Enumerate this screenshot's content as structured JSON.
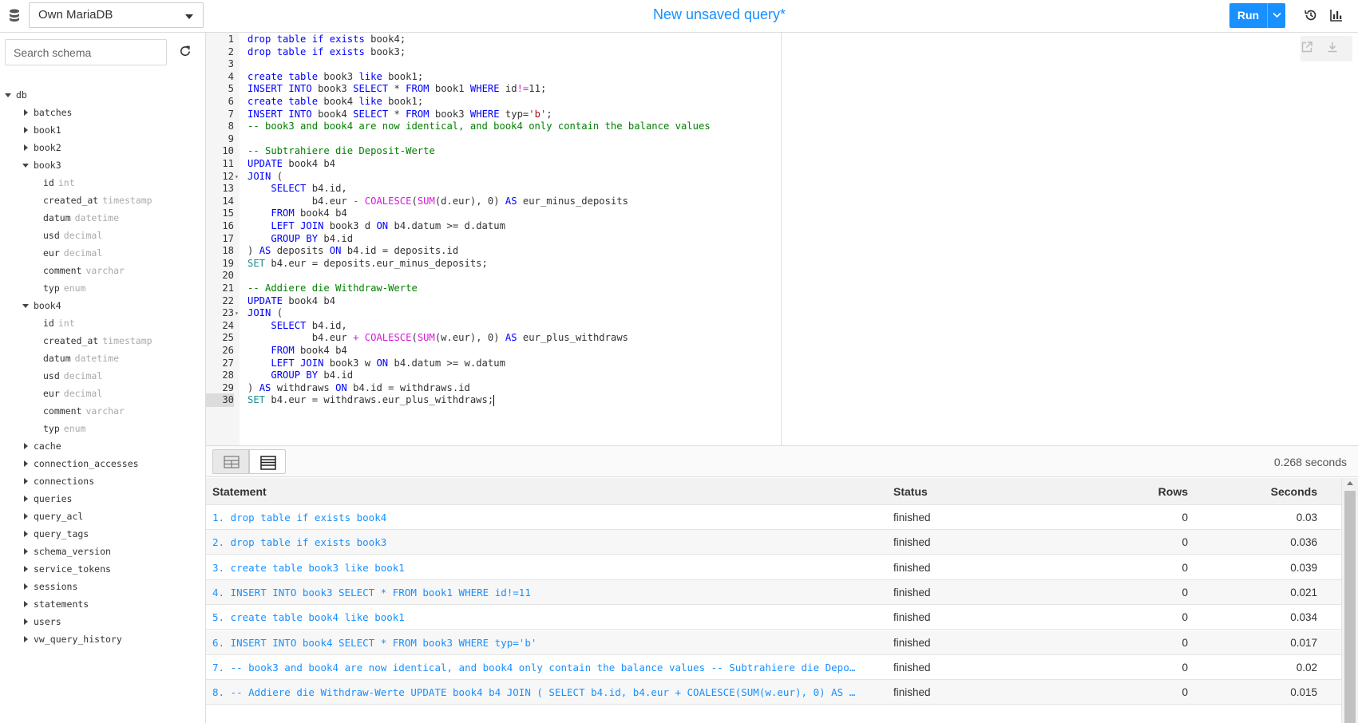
{
  "header": {
    "connection": "Own MariaDB",
    "query_title": "New unsaved query*",
    "run_label": "Run",
    "icons": [
      "database-icon",
      "history-icon",
      "chart-icon"
    ]
  },
  "sidebar": {
    "search_placeholder": "Search schema",
    "tree": [
      {
        "name": "db",
        "expanded": true,
        "level": 0
      },
      {
        "name": "batches",
        "level": 1
      },
      {
        "name": "book1",
        "level": 1
      },
      {
        "name": "book2",
        "level": 1
      },
      {
        "name": "book3",
        "level": 1,
        "expanded": true
      },
      {
        "name": "id",
        "type": "int",
        "level": 2
      },
      {
        "name": "created_at",
        "type": "timestamp",
        "level": 2
      },
      {
        "name": "datum",
        "type": "datetime",
        "level": 2
      },
      {
        "name": "usd",
        "type": "decimal",
        "level": 2
      },
      {
        "name": "eur",
        "type": "decimal",
        "level": 2
      },
      {
        "name": "comment",
        "type": "varchar",
        "level": 2
      },
      {
        "name": "typ",
        "type": "enum",
        "level": 2
      },
      {
        "name": "book4",
        "level": 1,
        "expanded": true
      },
      {
        "name": "id",
        "type": "int",
        "level": 2
      },
      {
        "name": "created_at",
        "type": "timestamp",
        "level": 2
      },
      {
        "name": "datum",
        "type": "datetime",
        "level": 2
      },
      {
        "name": "usd",
        "type": "decimal",
        "level": 2
      },
      {
        "name": "eur",
        "type": "decimal",
        "level": 2
      },
      {
        "name": "comment",
        "type": "varchar",
        "level": 2
      },
      {
        "name": "typ",
        "type": "enum",
        "level": 2
      },
      {
        "name": "cache",
        "level": 1
      },
      {
        "name": "connection_accesses",
        "level": 1
      },
      {
        "name": "connections",
        "level": 1
      },
      {
        "name": "queries",
        "level": 1
      },
      {
        "name": "query_acl",
        "level": 1
      },
      {
        "name": "query_tags",
        "level": 1
      },
      {
        "name": "schema_version",
        "level": 1
      },
      {
        "name": "service_tokens",
        "level": 1
      },
      {
        "name": "sessions",
        "level": 1
      },
      {
        "name": "statements",
        "level": 1
      },
      {
        "name": "users",
        "level": 1
      },
      {
        "name": "vw_query_history",
        "level": 1
      }
    ]
  },
  "editor": {
    "lines": [
      "drop table if exists book4;",
      "drop table if exists book3;",
      "",
      "create table book3 like book1;",
      "INSERT INTO book3 SELECT * FROM book1 WHERE id!=11;",
      "create table book4 like book1;",
      "INSERT INTO book4 SELECT * FROM book3 WHERE typ='b';",
      "-- book3 and book4 are now identical, and book4 only contain the balance values",
      "",
      "-- Subtrahiere die Deposit-Werte",
      "UPDATE book4 b4",
      "JOIN (",
      "    SELECT b4.id,",
      "           b4.eur - COALESCE(SUM(d.eur), 0) AS eur_minus_deposits",
      "    FROM book4 b4",
      "    LEFT JOIN book3 d ON b4.datum >= d.datum",
      "    GROUP BY b4.id",
      ") AS deposits ON b4.id = deposits.id",
      "SET b4.eur = deposits.eur_minus_deposits;",
      "",
      "-- Addiere die Withdraw-Werte",
      "UPDATE book4 b4",
      "JOIN (",
      "    SELECT b4.id,",
      "           b4.eur + COALESCE(SUM(w.eur), 0) AS eur_plus_withdraws",
      "    FROM book4 b4",
      "    LEFT JOIN book3 w ON b4.datum >= w.datum",
      "    GROUP BY b4.id",
      ") AS withdraws ON b4.id = withdraws.id",
      "SET b4.eur = withdraws.eur_plus_withdraws;"
    ],
    "fold_lines": [
      12,
      23
    ],
    "active_line": 30
  },
  "results": {
    "elapsed": "0.268 seconds",
    "columns": [
      "Statement",
      "Status",
      "Rows",
      "Seconds"
    ],
    "rows": [
      [
        "1. drop table if exists book4",
        "finished",
        "0",
        "0.03"
      ],
      [
        "2. drop table if exists book3",
        "finished",
        "0",
        "0.036"
      ],
      [
        "3. create table book3 like book1",
        "finished",
        "0",
        "0.039"
      ],
      [
        "4. INSERT INTO book3 SELECT * FROM book1 WHERE id!=11",
        "finished",
        "0",
        "0.021"
      ],
      [
        "5. create table book4 like book1",
        "finished",
        "0",
        "0.034"
      ],
      [
        "6. INSERT INTO book4 SELECT * FROM book3 WHERE typ='b'",
        "finished",
        "0",
        "0.017"
      ],
      [
        "7. -- book3 and book4 are now identical, and book4 only contain the balance values -- Subtrahiere die Depo…",
        "finished",
        "0",
        "0.02"
      ],
      [
        "8. -- Addiere die Withdraw-Werte UPDATE book4 b4 JOIN ( SELECT b4.id, b4.eur + COALESCE(SUM(w.eur), 0) AS …",
        "finished",
        "0",
        "0.015"
      ]
    ]
  }
}
